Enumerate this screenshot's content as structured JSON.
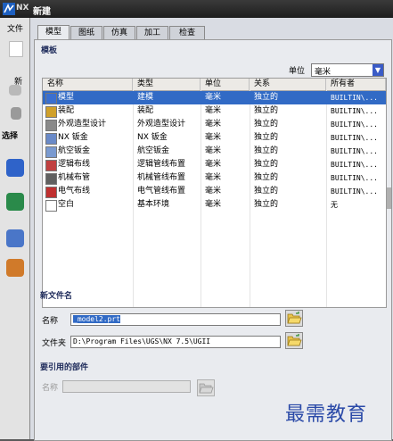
{
  "titlebar": {
    "app_title": "NX",
    "dialog_title": "新建"
  },
  "app": {
    "menu_file": "文件",
    "new_label": "新",
    "select_label": "选择"
  },
  "tabs": [
    {
      "label": "模型",
      "active": true
    },
    {
      "label": "图纸",
      "active": false
    },
    {
      "label": "仿真",
      "active": false
    },
    {
      "label": "加工",
      "active": false
    },
    {
      "label": "检查",
      "active": false
    }
  ],
  "templates": {
    "section_title": "模板",
    "unit_label": "单位",
    "unit_value": "毫米",
    "columns": [
      "名称",
      "类型",
      "单位",
      "关系",
      "所有者"
    ],
    "rows": [
      {
        "icon": "model-icon",
        "name": "模型",
        "type": "建模",
        "unit": "毫米",
        "relation": "独立的",
        "owner": "BUILTIN\\...",
        "selected": true
      },
      {
        "icon": "assembly-icon",
        "name": "装配",
        "type": "装配",
        "unit": "毫米",
        "relation": "独立的",
        "owner": "BUILTIN\\...",
        "selected": false
      },
      {
        "icon": "shape-design-icon",
        "name": "外观造型设计",
        "type": "外观造型设计",
        "unit": "毫米",
        "relation": "独立的",
        "owner": "BUILTIN\\...",
        "selected": false
      },
      {
        "icon": "sheet-metal-icon",
        "name": "NX 钣金",
        "type": "NX 钣金",
        "unit": "毫米",
        "relation": "独立的",
        "owner": "BUILTIN\\...",
        "selected": false
      },
      {
        "icon": "aero-sheet-metal-icon",
        "name": "航空钣金",
        "type": "航空钣金",
        "unit": "毫米",
        "relation": "独立的",
        "owner": "BUILTIN\\...",
        "selected": false
      },
      {
        "icon": "logic-routing-icon",
        "name": "逻辑布线",
        "type": "逻辑管线布置",
        "unit": "毫米",
        "relation": "独立的",
        "owner": "BUILTIN\\...",
        "selected": false
      },
      {
        "icon": "mechanical-routing-icon",
        "name": "机械布管",
        "type": "机械管线布置",
        "unit": "毫米",
        "relation": "独立的",
        "owner": "BUILTIN\\...",
        "selected": false
      },
      {
        "icon": "electrical-routing-icon",
        "name": "电气布线",
        "type": "电气管线布置",
        "unit": "毫米",
        "relation": "独立的",
        "owner": "BUILTIN\\...",
        "selected": false
      },
      {
        "icon": "blank-icon",
        "name": "空白",
        "type": "基本环境",
        "unit": "毫米",
        "relation": "独立的",
        "owner": "无",
        "selected": false
      }
    ]
  },
  "new_file": {
    "section_title": "新文件名",
    "name_label": "名称",
    "name_value": "_model2.prt",
    "folder_label": "文件夹",
    "folder_value": "D:\\Program Files\\UGS\\NX 7.5\\UGII"
  },
  "referenced_part": {
    "section_title": "要引用的部件",
    "name_label": "名称",
    "name_value": ""
  },
  "watermark": "最需教育",
  "colors": {
    "selection": "#316ac5",
    "section_title": "#1d2a5a",
    "watermark": "#2b4aa8"
  }
}
